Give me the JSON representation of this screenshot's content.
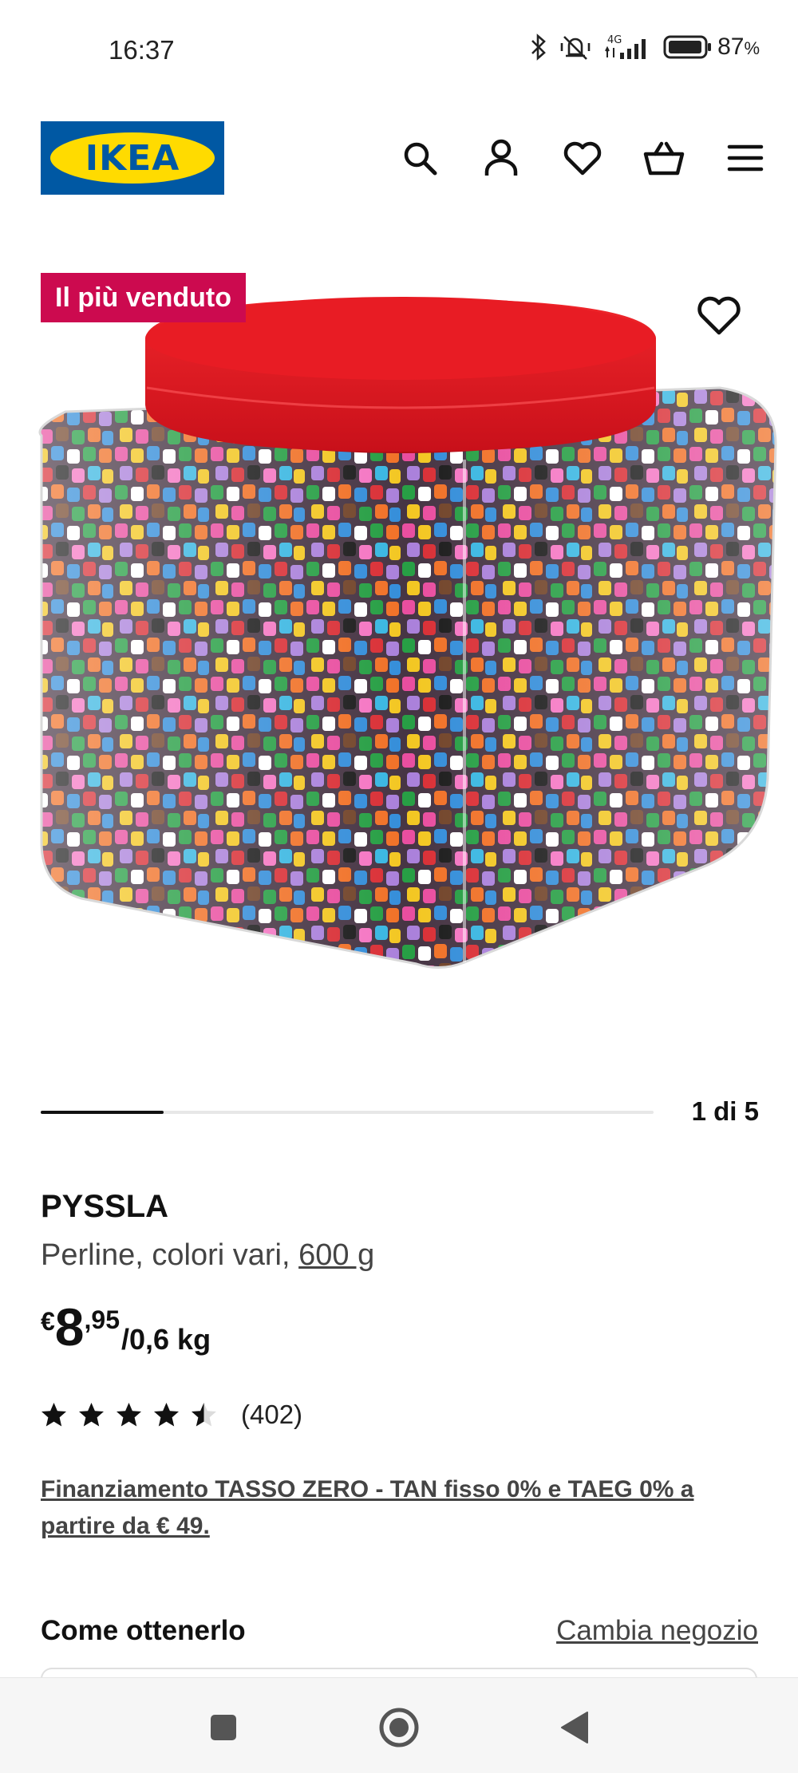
{
  "status_bar": {
    "time": "16:37",
    "battery": "87",
    "battery_unit": "%",
    "network": "4G",
    "icons": [
      "bluetooth-icon",
      "silent-vibrate-icon",
      "signal-icon",
      "battery-icon"
    ]
  },
  "header": {
    "logo_text": "IKEA",
    "icons": [
      "search-icon",
      "account-icon",
      "wishlist-icon",
      "cart-icon",
      "menu-icon"
    ],
    "brand_colors": {
      "blue": "#0058a3",
      "yellow": "#ffdb00"
    }
  },
  "media": {
    "badge": "Il più venduto",
    "badge_color": "#cc0a4f",
    "carousel_position": 1,
    "carousel_total": 5,
    "carousel_counter": "1 di 5"
  },
  "product": {
    "name": "PYSSLA",
    "description_prefix": "Perline, colori vari, ",
    "description_link": "600 g",
    "price_currency": "€",
    "price_integer": "8",
    "price_decimal": ",95",
    "price_unit": "/0,6 kg",
    "rating_value": 4.5,
    "rating_count": "(402)",
    "finance_text": "Finanziamento TASSO ZERO - TAN fisso 0% e TAEG 0% a partire da € 49."
  },
  "availability": {
    "title": "Come ottenerlo",
    "change_store": "Cambia negozio"
  },
  "system_nav": {
    "buttons": [
      "recents-button",
      "home-button",
      "back-button"
    ]
  }
}
